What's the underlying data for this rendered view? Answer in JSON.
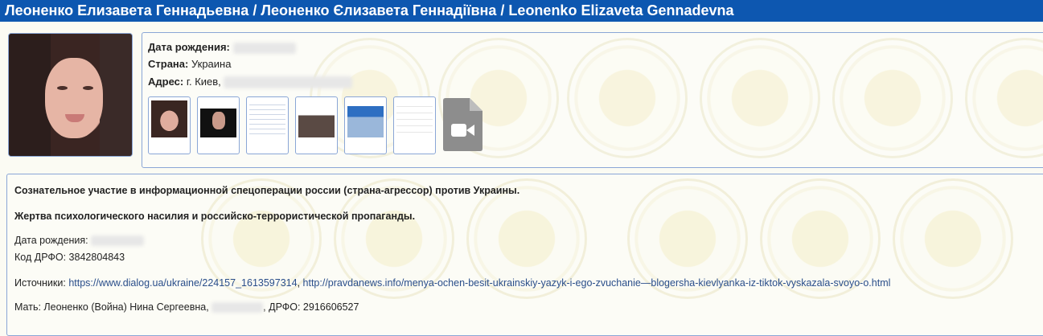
{
  "header": {
    "title": "Леоненко Елизавета Геннадьевна / Леоненко Єлизавета Геннадіївна / Leonenko Elizaveta Gennadevna"
  },
  "watermark": {
    "text": "МИРОТВОРЕЦЬ · PRO BONO PUBLICO"
  },
  "profile": {
    "birth_label": "Дата рождения:",
    "country_label": "Страна:",
    "country_value": "Украина",
    "address_label": "Адрес:",
    "address_value": "г. Киев,"
  },
  "gallery": {
    "video_icon": "video-file-icon"
  },
  "details": {
    "statement_1": "Сознательное участие в информационной спецоперации россии (страна-агрессор) против Украины.",
    "statement_2": "Жертва психологического насилия и российско-террористической пропаганды.",
    "birth_label": "Дата рождения:",
    "inn_line": "Код ДРФО: 3842804843",
    "sources_label": "Источники:",
    "source_1": "https://www.dialog.ua/ukraine/224157_1613597314",
    "source_sep": ",",
    "source_2": "http://pravdanews.info/menya-ochen-besit-ukrainskiy-yazyk-i-ego-zvuchanie—blogersha-kievlyanka-iz-tiktok-vyskazala-svoyo-o.html",
    "mother_prefix": "Мать: Леоненко (Война) Нина Сергеевна,",
    "mother_suffix": ", ДРФО: 2916606527"
  },
  "colors": {
    "header_bg": "#0d57b0",
    "border": "#8aa6d6",
    "link": "#2a4e8a"
  }
}
